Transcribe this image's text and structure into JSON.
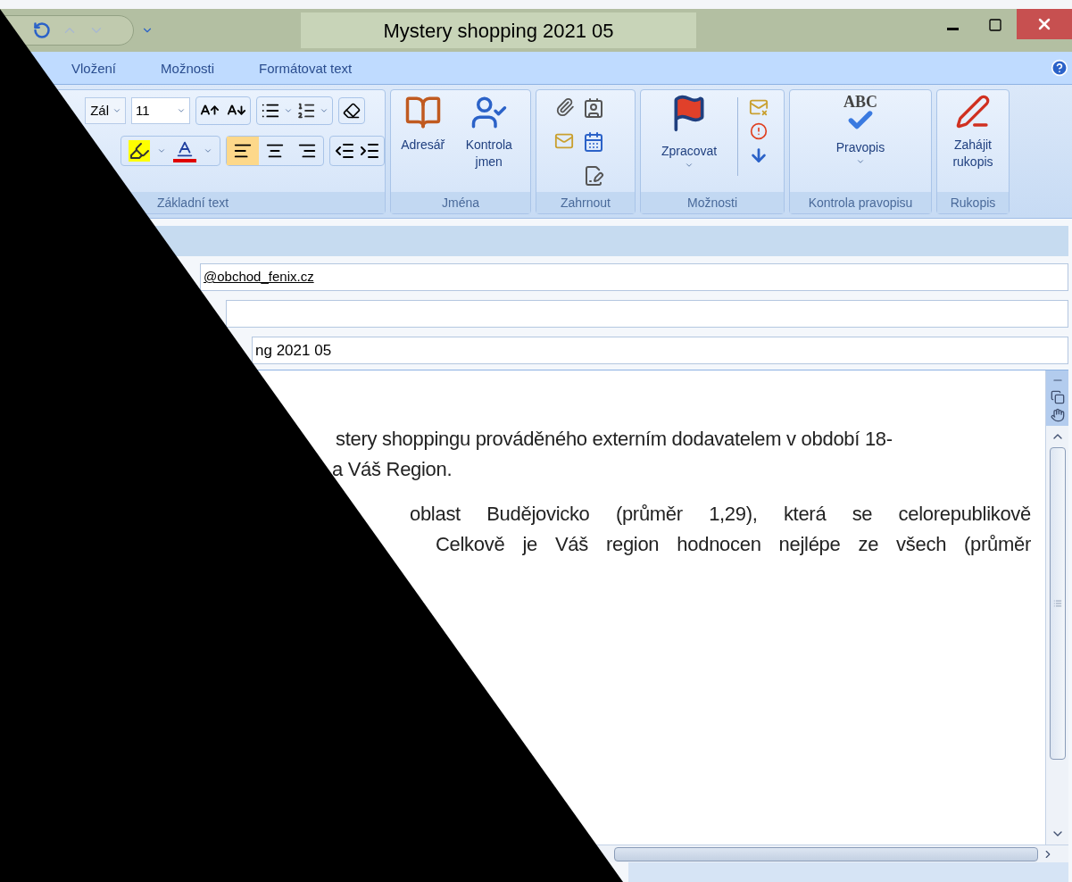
{
  "window": {
    "title": "Mystery shopping 2021 05"
  },
  "tabs": [
    {
      "label": "Vložení",
      "selected": false
    },
    {
      "label": "Možnosti",
      "selected": false
    },
    {
      "label": "Formátovat text",
      "selected": false
    }
  ],
  "ribbon": {
    "basic_text": {
      "label": "Základní text",
      "font_name": "Zál",
      "font_size": "11",
      "align": [
        {
          "kind": "left",
          "selected": true
        },
        {
          "kind": "center",
          "selected": false
        },
        {
          "kind": "right",
          "selected": false
        }
      ]
    },
    "names": {
      "label": "Jména",
      "buttons": [
        "Adresář",
        "Kontrola jmen"
      ]
    },
    "include": {
      "label": "Zahrnout"
    },
    "options": {
      "label": "Možnosti",
      "button": "Zpracovat"
    },
    "proofing": {
      "label": "Kontrola pravopisu",
      "button": "Pravopis",
      "icon_text": "ABC"
    },
    "ink": {
      "label": "Rukopis",
      "button": "Zahájit rukopis"
    }
  },
  "fields": [
    {
      "kind": "link",
      "value": "@obchod_fenix.cz"
    },
    {
      "kind": "blank"
    },
    {
      "kind": "plain",
      "value": "ng 2021 05"
    }
  ],
  "body": {
    "lines": [
      "stery shoppingu prováděného externím dodavatelem v období 18-",
      "a Váš Region.",
      "oblast Budějovicko (průměr 1,29), která se celorepublikově",
      "Celkově je Váš region hodnocen nejlépe ze všech (průměr"
    ]
  }
}
